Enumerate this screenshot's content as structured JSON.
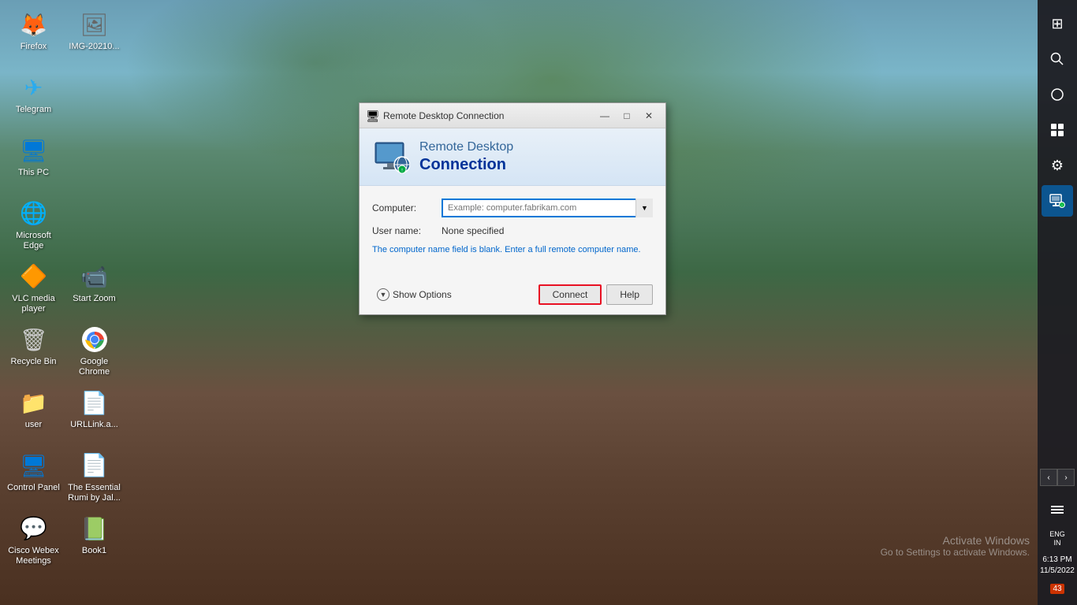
{
  "desktop": {
    "background_desc": "Outdoor scene with trees and waterfront balustrade"
  },
  "icons": [
    {
      "id": "firefox",
      "label": "Firefox",
      "emoji": "🦊",
      "col": 1,
      "row": 1
    },
    {
      "id": "telegram",
      "label": "Telegram",
      "emoji": "✈",
      "col": 1,
      "row": 2
    },
    {
      "id": "thispc",
      "label": "This PC",
      "emoji": "🖥",
      "col": 1,
      "row": 3
    },
    {
      "id": "msedge",
      "label": "Microsoft Edge",
      "emoji": "🌐",
      "col": 1,
      "row": 4
    },
    {
      "id": "vlc",
      "label": "VLC media player",
      "emoji": "🔶",
      "col": 1,
      "row": 5
    },
    {
      "id": "zoom",
      "label": "Start Zoom",
      "emoji": "📹",
      "col": 2,
      "row": 5
    },
    {
      "id": "recycle",
      "label": "Recycle Bin",
      "emoji": "🗑",
      "col": 1,
      "row": 6
    },
    {
      "id": "chrome",
      "label": "Google Chrome",
      "emoji": "⬤",
      "col": 2,
      "row": 6
    },
    {
      "id": "user",
      "label": "user",
      "emoji": "📁",
      "col": 1,
      "row": 7
    },
    {
      "id": "urllink",
      "label": "URLLink.a...",
      "emoji": "📄",
      "col": 2,
      "row": 7
    },
    {
      "id": "cpanel",
      "label": "Control Panel",
      "emoji": "🖥",
      "col": 1,
      "row": 8
    },
    {
      "id": "rumi",
      "label": "The Essential Rumi by Jal...",
      "emoji": "📄",
      "col": 2,
      "row": 8
    },
    {
      "id": "webex",
      "label": "Cisco Webex Meetings",
      "emoji": "💬",
      "col": 1,
      "row": 9
    },
    {
      "id": "book",
      "label": "Book1",
      "emoji": "📗",
      "col": 2,
      "row": 9
    },
    {
      "id": "img",
      "label": "IMG-20210...",
      "emoji": "🖼",
      "col": 2,
      "row": 2
    }
  ],
  "sidebar": {
    "icons": [
      {
        "id": "windows",
        "symbol": "⊞",
        "label": "Start"
      },
      {
        "id": "search",
        "symbol": "🔍",
        "label": "Search"
      },
      {
        "id": "task-view",
        "symbol": "⊙",
        "label": "Task View"
      },
      {
        "id": "multitasking",
        "symbol": "⊟",
        "label": "Widgets"
      },
      {
        "id": "settings",
        "symbol": "⚙",
        "label": "Settings"
      },
      {
        "id": "rdc-icon",
        "symbol": "🖥",
        "label": "Remote Desktop",
        "active": true
      }
    ]
  },
  "taskbar": {
    "time": "6:13 PM",
    "date": "11/5/2022",
    "lang": "ENG\nIN",
    "notifications": "43"
  },
  "activate_windows": {
    "line1": "Activate Windows",
    "line2": "Go to Settings to activate Windows."
  },
  "rdc_dialog": {
    "title_bar": "Remote Desktop Connection",
    "title_icon": "🖥",
    "header_line1": "Remote Desktop",
    "header_line2": "Connection",
    "computer_label": "Computer:",
    "computer_placeholder": "Example: computer.fabrikam.com",
    "username_label": "User name:",
    "username_value": "None specified",
    "warning_text": "The computer name field is blank. Enter a full remote computer name.",
    "show_options_label": "Show Options",
    "connect_label": "Connect",
    "help_label": "Help",
    "minimize_btn": "—",
    "maximize_btn": "□",
    "close_btn": "✕"
  }
}
